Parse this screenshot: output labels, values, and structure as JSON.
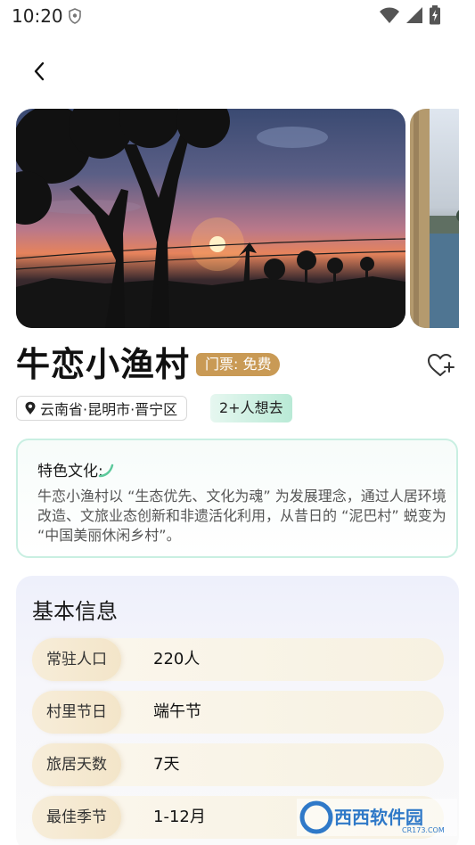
{
  "status_bar": {
    "time": "10:20",
    "icons": [
      "shield-icon",
      "wifi-icon",
      "signal-icon",
      "battery-charging-icon"
    ]
  },
  "header": {
    "back_icon": "chevron-left-icon"
  },
  "carousel": {
    "images": [
      "sunset-village-silhouette",
      "lake-shore-tree"
    ]
  },
  "attraction": {
    "name": "牛恋小渔村",
    "ticket": "门票: 免费",
    "favorite_icon": "heart-plus-icon",
    "location": "云南省·昆明市·晋宁区",
    "wants_to_go": "2+人想去"
  },
  "culture": {
    "title": "特色文化:",
    "body": "牛恋小渔村以 “生态优先、文化为魂” 为发展理念，通过人居环境改造、文旅业态创新和非遗活化利用，从昔日的 “泥巴村” 蜕变为 “中国美丽休闲乡村”。"
  },
  "basic_info": {
    "title": "基本信息",
    "rows": [
      {
        "key": "常驻人口",
        "value": "220人"
      },
      {
        "key": "村里节日",
        "value": "端午节"
      },
      {
        "key": "旅居天数",
        "value": "7天"
      },
      {
        "key": "最佳季节",
        "value": "1-12月"
      }
    ]
  },
  "watermark": {
    "text": "西西软件园",
    "sub": "CR173.COM"
  },
  "colors": {
    "ticket_badge": "#c99a55",
    "culture_border": "#c9efe2",
    "wants_pill": "#b9ead6"
  }
}
